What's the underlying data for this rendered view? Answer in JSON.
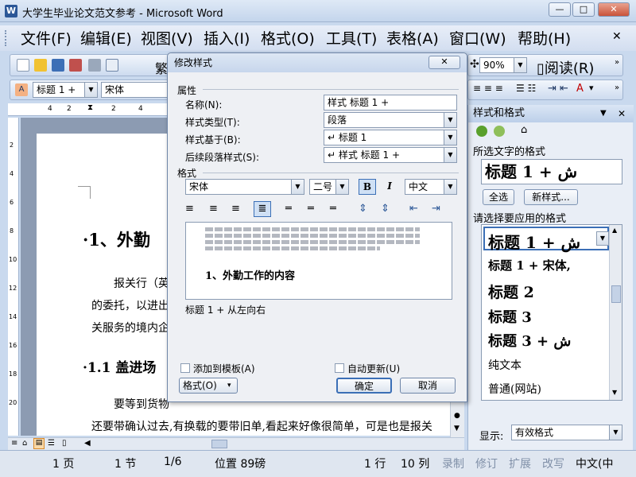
{
  "window": {
    "icon_label": "W",
    "title": "大学生毕业论文范文参考 - Microsoft Word",
    "minimize": "—",
    "maximize": "□",
    "close": "✕"
  },
  "menu": [
    "文件(F)",
    "编辑(E)",
    "视图(V)",
    "插入(I)",
    "格式(O)",
    "工具(T)",
    "表格(A)",
    "窗口(W)",
    "帮助(H)"
  ],
  "menu_close": "✕",
  "toolbar": {
    "zoom": "90%",
    "read": "阅读(R)",
    "style_box": "标题 1 +",
    "font_box": "宋体",
    "partial_label": "繁",
    "icons": [
      "new-icon",
      "open-icon",
      "save-icon",
      "permission-icon",
      "print-icon",
      "preview-icon"
    ]
  },
  "ruler": {
    "ticks_h": [
      "4",
      "2",
      "2",
      "4"
    ],
    "ticks_v": [
      "2",
      "4",
      "6",
      "8",
      "10",
      "12",
      "14",
      "16",
      "18",
      "20"
    ]
  },
  "document": {
    "heading1": "·1、外勤",
    "para1": "报关行（英",
    "para2": "的委托，以进出",
    "para3": "关服务的境内企",
    "heading2": "·1.1 盖进场",
    "para4": "要等到货物",
    "para5": "还要带确认过去,有换载的要带旧单,看起来好像很简单，可是也是报关"
  },
  "dialog": {
    "title": "修改样式",
    "close": "✕",
    "section_props": "属性",
    "name_label": "名称(N):",
    "name_value": "样式 标题 1 +",
    "type_label": "样式类型(T):",
    "type_value": "段落",
    "based_label": "样式基于(B):",
    "based_value": "↵ 标题 1",
    "next_label": "后续段落样式(S):",
    "next_value": "↵ 样式 标题 1 +",
    "section_format": "格式",
    "font_value": "宋体",
    "size_value": "二号",
    "bold": "B",
    "italic": "I",
    "lang_value": "中文",
    "preview_text": "1、外勤工作的内容",
    "description": "标题 1 + 从左向右",
    "add_template": "添加到模板(A)",
    "auto_update": "自动更新(U)",
    "format_button": "格式(O)",
    "ok": "确定",
    "cancel": "取消"
  },
  "task_pane": {
    "title": "样式和格式",
    "selected_label": "所选文字的格式",
    "selected_value": "标题 1 + ش",
    "select_all": "全选",
    "new_style": "新样式...",
    "apply_label": "请选择要应用的格式",
    "styles": [
      {
        "label": "标题 1 + ش",
        "size": "20px"
      },
      {
        "label": "标题 1 + 宋体,",
        "size": "15px"
      },
      {
        "label": "标题 2",
        "size": "19px"
      },
      {
        "label": "标题 3",
        "size": "18px"
      },
      {
        "label": "标题 3 + ش",
        "size": "18px"
      },
      {
        "label": "纯文本",
        "size": "14px"
      },
      {
        "label": "普通(网站)",
        "size": "14px"
      }
    ],
    "show_label": "显示:",
    "show_value": "有效格式"
  },
  "status": {
    "page": "1 页",
    "section": "1 节",
    "page_of": "1/6",
    "position": "位置 89磅",
    "line": "1 行",
    "col": "10 列",
    "rec": "录制",
    "trk": "修订",
    "ext": "扩展",
    "ovr": "改写",
    "lang": "中文(中"
  },
  "colors": {
    "accent": "#2b5797",
    "bg": "#c9d9ee"
  }
}
